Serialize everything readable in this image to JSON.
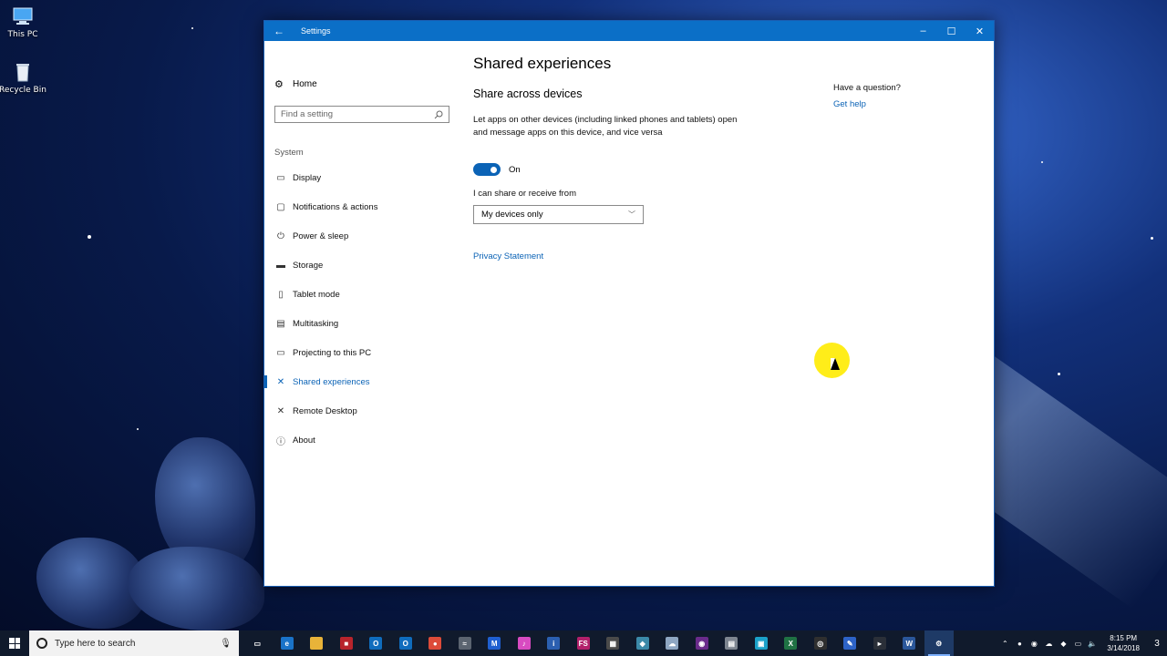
{
  "desktop": {
    "icons": [
      {
        "label": "This PC",
        "icon": "computer-icon"
      },
      {
        "label": "Recycle Bin",
        "icon": "recycle-bin-icon"
      }
    ]
  },
  "window": {
    "title": "Settings",
    "back_icon": "back-arrow-icon",
    "minimize_glyph": "–",
    "maximize_glyph": "☐",
    "close_glyph": "✕"
  },
  "nav": {
    "home": "Home",
    "search_placeholder": "Find a setting",
    "section": "System",
    "items": [
      {
        "label": "Display",
        "icon": "display-icon"
      },
      {
        "label": "Notifications & actions",
        "icon": "notifications-icon"
      },
      {
        "label": "Power & sleep",
        "icon": "power-icon"
      },
      {
        "label": "Storage",
        "icon": "storage-icon"
      },
      {
        "label": "Tablet mode",
        "icon": "tablet-icon"
      },
      {
        "label": "Multitasking",
        "icon": "multitasking-icon"
      },
      {
        "label": "Projecting to this PC",
        "icon": "projecting-icon"
      },
      {
        "label": "Shared experiences",
        "icon": "shared-icon",
        "active": true
      },
      {
        "label": "Remote Desktop",
        "icon": "remote-desktop-icon"
      },
      {
        "label": "About",
        "icon": "info-icon"
      }
    ]
  },
  "main": {
    "title": "Shared experiences",
    "subtitle": "Share across devices",
    "description": "Let apps on other devices (including linked phones and tablets) open and message apps on this device, and vice versa",
    "toggle_state": "On",
    "share_label": "I can share or receive from",
    "dropdown_value": "My devices only",
    "privacy_link": "Privacy Statement"
  },
  "help": {
    "question": "Have a question?",
    "link": "Get help"
  },
  "taskbar": {
    "search_placeholder": "Type here to search",
    "time": "8:15 PM",
    "date": "3/14/2018",
    "notification_count": "3",
    "apps": [
      {
        "name": "task-view",
        "color": "#101a2c",
        "glyph": "▭"
      },
      {
        "name": "edge",
        "color": "#1a73c8",
        "glyph": "e"
      },
      {
        "name": "file-explorer",
        "color": "#e8b339",
        "glyph": ""
      },
      {
        "name": "app-red",
        "color": "#b8242c",
        "glyph": "■"
      },
      {
        "name": "outlook",
        "color": "#0f6cbd",
        "glyph": "O"
      },
      {
        "name": "outlook-2",
        "color": "#0f6cbd",
        "glyph": "O"
      },
      {
        "name": "chrome",
        "color": "#dd4b39",
        "glyph": "●"
      },
      {
        "name": "app-gray",
        "color": "#5b6470",
        "glyph": "≈"
      },
      {
        "name": "malwarebytes",
        "color": "#1f5fd0",
        "glyph": "M"
      },
      {
        "name": "itunes",
        "color": "#d84bc1",
        "glyph": "♪"
      },
      {
        "name": "app-info",
        "color": "#2b5fb0",
        "glyph": "i"
      },
      {
        "name": "fs-app",
        "color": "#b3206b",
        "glyph": "FS"
      },
      {
        "name": "calculator",
        "color": "#4a4a4a",
        "glyph": "▦"
      },
      {
        "name": "app-teal",
        "color": "#3b89a8",
        "glyph": "◆"
      },
      {
        "name": "app-cloud",
        "color": "#8ea6c2",
        "glyph": "☁"
      },
      {
        "name": "app-circle",
        "color": "#6a2b8b",
        "glyph": "◉"
      },
      {
        "name": "app-gray-2",
        "color": "#7d8590",
        "glyph": "▤"
      },
      {
        "name": "app-cyan",
        "color": "#1ba1c9",
        "glyph": "▣"
      },
      {
        "name": "excel-app",
        "color": "#1f7244",
        "glyph": "X"
      },
      {
        "name": "obs",
        "color": "#2f2f2f",
        "glyph": "◎"
      },
      {
        "name": "app-blue-2",
        "color": "#2d63c8",
        "glyph": "✎"
      },
      {
        "name": "app-dark",
        "color": "#2a2f38",
        "glyph": "▸"
      },
      {
        "name": "word",
        "color": "#2b579a",
        "glyph": "W"
      },
      {
        "name": "settings",
        "color": "#1e3a66",
        "glyph": "⚙",
        "active": true
      }
    ]
  }
}
